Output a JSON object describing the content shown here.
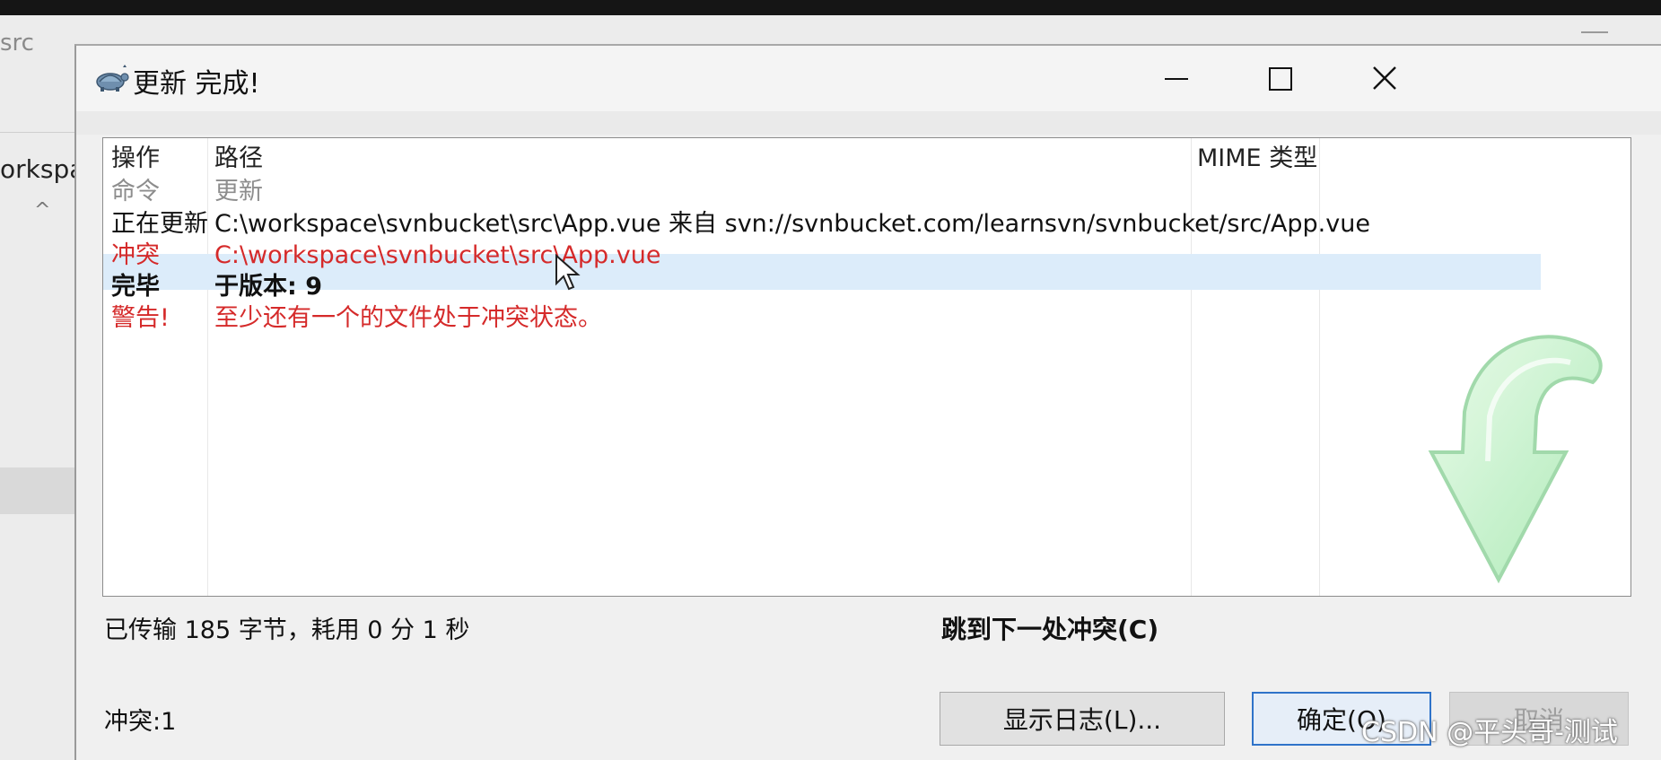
{
  "background_window": {
    "title": "src",
    "path_fragment": "orkspa",
    "chevron": "^"
  },
  "dialog": {
    "title": "更新 完成!",
    "app_icon": "tortoisesvn-icon",
    "controls": {
      "minimize": "minimize-icon",
      "maximize": "maximize-icon",
      "close": "✕"
    }
  },
  "list": {
    "columns": [
      "操作",
      "路径",
      "MIME 类型"
    ],
    "rows": [
      {
        "action": "命令",
        "path": "更新",
        "style": "gray"
      },
      {
        "action": "正在更新",
        "path": "C:\\workspace\\svnbucket\\src\\App.vue 来自 svn://svnbucket.com/learnsvn/svnbucket/src/App.vue",
        "style": "normal"
      },
      {
        "action": "冲突",
        "path": "C:\\workspace\\svnbucket\\src\\App.vue",
        "style": "conflict-selected"
      },
      {
        "action": "完毕",
        "path": "于版本: 9",
        "style": "bold"
      },
      {
        "action": "警告!",
        "path": "至少还有一个的文件处于冲突状态。",
        "style": "warning"
      }
    ],
    "decoration": "update-arrow-icon"
  },
  "status": {
    "transferred": "已传输 185 字节，耗用 0 分 1 秒",
    "next_conflict": "跳到下一处冲突(C)",
    "conflict_count": "冲突:1"
  },
  "buttons": {
    "show_log": "显示日志(L)...",
    "ok": "确定(O)",
    "cancel": "取消"
  },
  "watermark": "CSDN @平头哥-测试",
  "colors": {
    "conflict_text": "#d52a2a",
    "selection": "#dcecfa",
    "ok_border": "#2f73c9"
  }
}
